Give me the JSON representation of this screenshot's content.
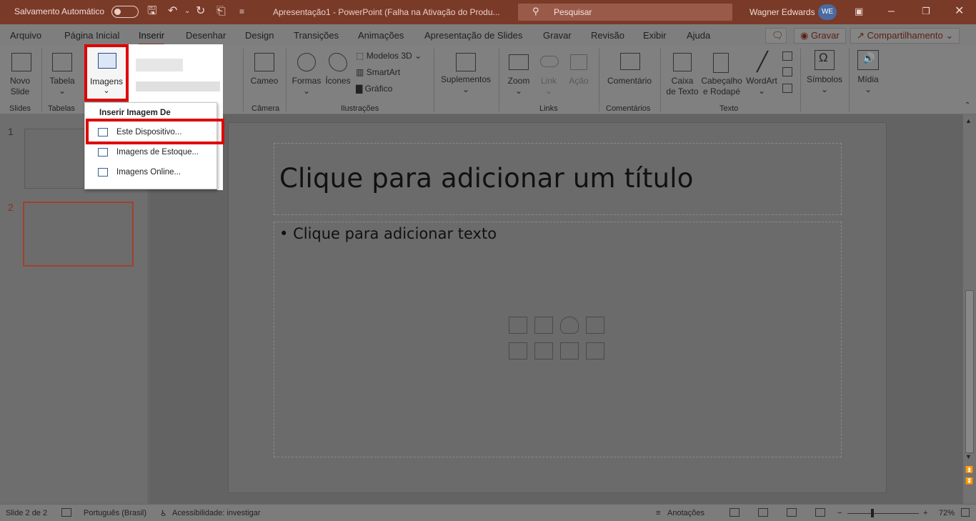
{
  "titlebar": {
    "autosave_label": "Salvamento Automático",
    "doc_title": "Apresentação1  -  PowerPoint (Falha na Ativação do Produ...",
    "search_placeholder": "Pesquisar",
    "user_name": "Wagner Edwards",
    "user_initials": "WE"
  },
  "tabs": [
    "Arquivo",
    "Página Inicial",
    "Inserir",
    "Desenhar",
    "Design",
    "Transições",
    "Animações",
    "Apresentação de Slides",
    "Gravar",
    "Revisão",
    "Exibir",
    "Ajuda"
  ],
  "active_tab": "Inserir",
  "ribbon_actions": {
    "record": "Gravar",
    "share": "Compartilhamento"
  },
  "ribbon": {
    "new_slide": "Novo",
    "new_slide_2": "Slide",
    "table": "Tabela",
    "images": "Imagens",
    "cameo": "Cameo",
    "shapes": "Formas",
    "icons": "Ícones",
    "models3d": "Modelos 3D",
    "smartart": "SmartArt",
    "chart": "Gráfico",
    "addins": "Suplementos",
    "zoom": "Zoom",
    "link": "Link",
    "action": "Ação",
    "comment": "Comentário",
    "textbox_1": "Caixa",
    "textbox_2": "de Texto",
    "headerfooter_1": "Cabeçalho",
    "headerfooter_2": "e Rodapé",
    "wordart": "WordArt",
    "symbols": "Símbolos",
    "media": "Mídia",
    "groups": {
      "slides": "Slides",
      "tables": "Tabelas",
      "camera": "Câmera",
      "illustrations": "Ilustrações",
      "links": "Links",
      "comments": "Comentários",
      "text": "Texto"
    }
  },
  "dropdown": {
    "header": "Inserir Imagem De",
    "items": [
      "Este Dispositivo...",
      "Imagens de Estoque...",
      "Imagens Online..."
    ]
  },
  "slides_panel": {
    "numbers": [
      "1",
      "2"
    ]
  },
  "slide": {
    "title_placeholder": "Clique para adicionar um título",
    "body_placeholder": "Clique para adicionar texto"
  },
  "status": {
    "slide_count": "Slide 2 de 2",
    "language": "Português (Brasil)",
    "accessibility": "Acessibilidade: investigar",
    "notes": "Anotações",
    "zoom_minus": "−",
    "zoom_plus": "+",
    "zoom_level": "72%"
  },
  "colors": {
    "titlebar": "#7a3a28",
    "highlight": "#e00000"
  }
}
